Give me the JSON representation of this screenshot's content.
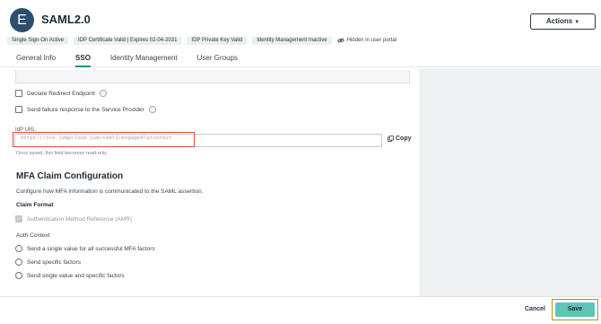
{
  "app": {
    "avatar_letter": "E",
    "title": "SAML2.0"
  },
  "actions": {
    "label": "Actions"
  },
  "badges": [
    "Single Sign-On Active",
    "IDP Certificate Valid | Expires 02-04-2031",
    "IDP Private Key Valid",
    "Identity Management Inactive"
  ],
  "hidden_note": "Hidden in user portal",
  "tabs": [
    {
      "label": "General Info",
      "active": false
    },
    {
      "label": "SSO",
      "active": true
    },
    {
      "label": "Identity Management",
      "active": false
    },
    {
      "label": "User Groups",
      "active": false
    }
  ],
  "options": {
    "declare_redirect": "Declare Redirect Endpoint",
    "send_failure": "Send failure response to the Service Provider"
  },
  "idp_url": {
    "label": "IdP URL:",
    "value": "https://sso.jumpcloud.com/saml2/engagedlyssotest",
    "copy_label": "Copy",
    "hint": "Once saved, this field becomes read-only."
  },
  "mfa": {
    "title": "MFA Claim Configuration",
    "description": "Configure how MFA information is communicated to the SAML assertion.",
    "claim_format_label": "Claim Format",
    "amr_label": "Authentication Method Reference (AMR)",
    "auth_context_label": "Auth Context",
    "radios": [
      "Send a single value for all successful MFA factors",
      "Send specific factors",
      "Send single value and specific factors"
    ]
  },
  "footer": {
    "cancel": "Cancel",
    "save": "Save"
  }
}
